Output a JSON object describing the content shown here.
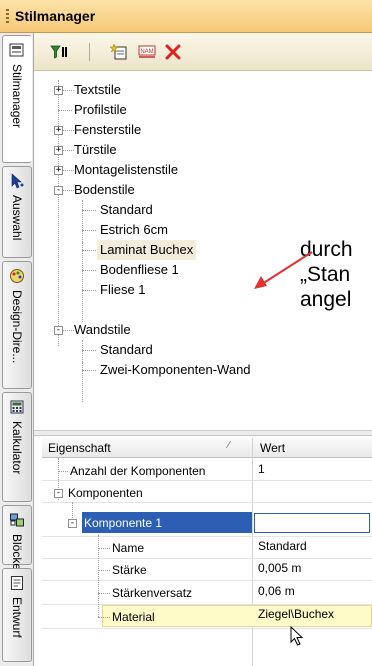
{
  "window": {
    "title": "Stilmanager"
  },
  "side_tabs": [
    {
      "label": "Stilmanager",
      "icon": "style-manager-icon"
    },
    {
      "label": "Auswahl",
      "icon": "cursor-select-icon"
    },
    {
      "label": "Design-Dire...",
      "icon": "design-palette-icon"
    },
    {
      "label": "Kalkulator",
      "icon": "calculator-icon"
    },
    {
      "label": "Blöcke",
      "icon": "blocks-icon"
    },
    {
      "label": "Entwurf",
      "icon": "draft-icon"
    }
  ],
  "toolbar": {
    "buttons": [
      "filter-icon",
      "new-style-icon",
      "rename-icon",
      "delete-icon"
    ],
    "delete_color": "#e02020"
  },
  "tree": {
    "items": [
      {
        "label": "Textstile",
        "expander": "+"
      },
      {
        "label": "Profilstile",
        "expander": ""
      },
      {
        "label": "Fensterstile",
        "expander": "+"
      },
      {
        "label": "Türstile",
        "expander": "+"
      },
      {
        "label": "Montagelistenstile",
        "expander": "+"
      },
      {
        "label": "Bodenstile",
        "expander": "-"
      },
      {
        "label": "Standard",
        "expander": ""
      },
      {
        "label": "Estrich 6cm",
        "expander": ""
      },
      {
        "label": "Laminat Buchex",
        "expander": ""
      },
      {
        "label": "Bodenfliese 1",
        "expander": ""
      },
      {
        "label": "Fliese 1",
        "expander": ""
      },
      {
        "label": "Wandstile",
        "expander": "-"
      },
      {
        "label": "Standard",
        "expander": ""
      },
      {
        "label": "Zwei-Komponenten-Wand",
        "expander": ""
      }
    ]
  },
  "annotation": {
    "lines": [
      "durch",
      "„Stan",
      "angel"
    ],
    "arrow_color": "#e03030"
  },
  "properties": {
    "headers": {
      "property": "Eigenschaft",
      "value": "Wert"
    },
    "rows": [
      {
        "name": "Anzahl der Komponenten",
        "value": "1",
        "expander": ""
      },
      {
        "name": "Komponenten",
        "value": "",
        "expander": "-"
      },
      {
        "name": "Komponente 1",
        "value": "",
        "expander": "-"
      },
      {
        "name": "Name",
        "value": "Standard",
        "expander": ""
      },
      {
        "name": "Stärke",
        "value": "0,005 m",
        "expander": ""
      },
      {
        "name": "Stärkenversatz",
        "value": "0,06 m",
        "expander": ""
      },
      {
        "name": "Material",
        "value": "Ziegel\\Buchex",
        "expander": ""
      }
    ],
    "selected_color": "#2c5fb4",
    "highlight_color": "#fefbc8"
  }
}
